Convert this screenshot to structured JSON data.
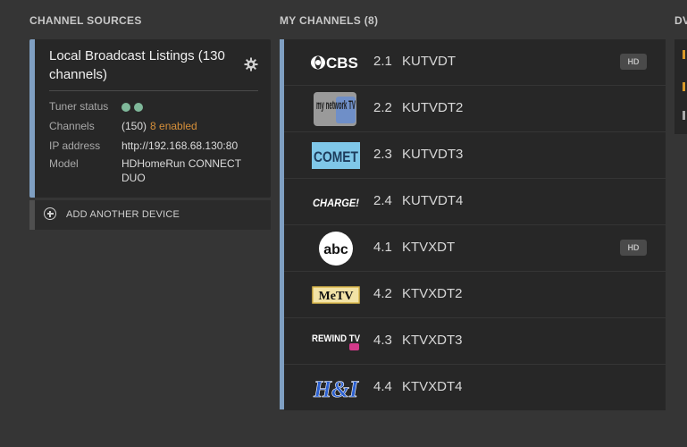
{
  "sections": {
    "channel_sources": "CHANNEL SOURCES",
    "my_channels": "MY CHANNELS (8)",
    "third": "DV"
  },
  "device": {
    "title": "Local Broadcast Listings (130 channels)",
    "rows": {
      "tuner_label": "Tuner status",
      "channels_label": "Channels",
      "channels_total": "(150)",
      "channels_enabled": "8 enabled",
      "ip_label": "IP address",
      "ip_value": "http://192.168.68.130:80",
      "model_label": "Model",
      "model_value": "HDHomeRun CONNECT DUO"
    },
    "icon": "gear-icon",
    "status_color": "#7fb89a"
  },
  "add_device": {
    "label": "ADD ANOTHER DEVICE",
    "icon": "plus-circle-icon"
  },
  "channels": [
    {
      "logo": "CBS",
      "number": "2.1",
      "name": "KUTVDT",
      "hd": "HD"
    },
    {
      "logo": "my network TV",
      "number": "2.2",
      "name": "KUTVDT2",
      "hd": ""
    },
    {
      "logo": "COMET",
      "number": "2.3",
      "name": "KUTVDT3",
      "hd": ""
    },
    {
      "logo": "CHARGE!",
      "number": "2.4",
      "name": "KUTVDT4",
      "hd": ""
    },
    {
      "logo": "abc",
      "number": "4.1",
      "name": "KTVXDT",
      "hd": "HD"
    },
    {
      "logo": "MeTV",
      "number": "4.2",
      "name": "KTVXDT2",
      "hd": ""
    },
    {
      "logo": "REWIND TV",
      "number": "4.3",
      "name": "KTVXDT3",
      "hd": ""
    },
    {
      "logo": "H&I",
      "number": "4.4",
      "name": "KTVXDT4",
      "hd": ""
    }
  ],
  "colors": {
    "accent": "#7f9fc2",
    "enabled_text": "#d58f3a",
    "background": "#353535"
  }
}
